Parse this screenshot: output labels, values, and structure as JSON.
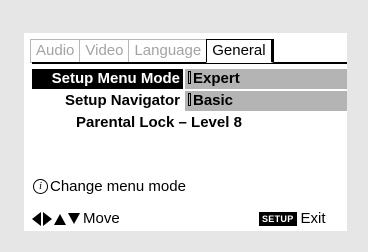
{
  "tabs": [
    {
      "label": "Audio",
      "active": false
    },
    {
      "label": "Video",
      "active": false
    },
    {
      "label": "Language",
      "active": false
    },
    {
      "label": "General",
      "active": true
    }
  ],
  "menu": {
    "items": [
      {
        "label": "Setup Menu Mode",
        "selected": true
      },
      {
        "label": "Setup Navigator",
        "selected": false
      },
      {
        "label": "Parental Lock – Level 8",
        "selected": false
      }
    ],
    "options": [
      {
        "label": "Expert"
      },
      {
        "label": "Basic"
      }
    ]
  },
  "info": {
    "icon": "info-icon",
    "text": "Change menu mode"
  },
  "footer": {
    "nav_icons": [
      "arrow-left-icon",
      "arrow-right-icon",
      "arrow-up-icon",
      "arrow-down-icon"
    ],
    "move_label": "Move",
    "setup_key_label": "SETUP",
    "exit_label": "Exit"
  },
  "colors": {
    "background": "#e6e6e6",
    "panel": "#ffffff",
    "selected_bg": "#000000",
    "option_bg": "#b4b4b4"
  }
}
